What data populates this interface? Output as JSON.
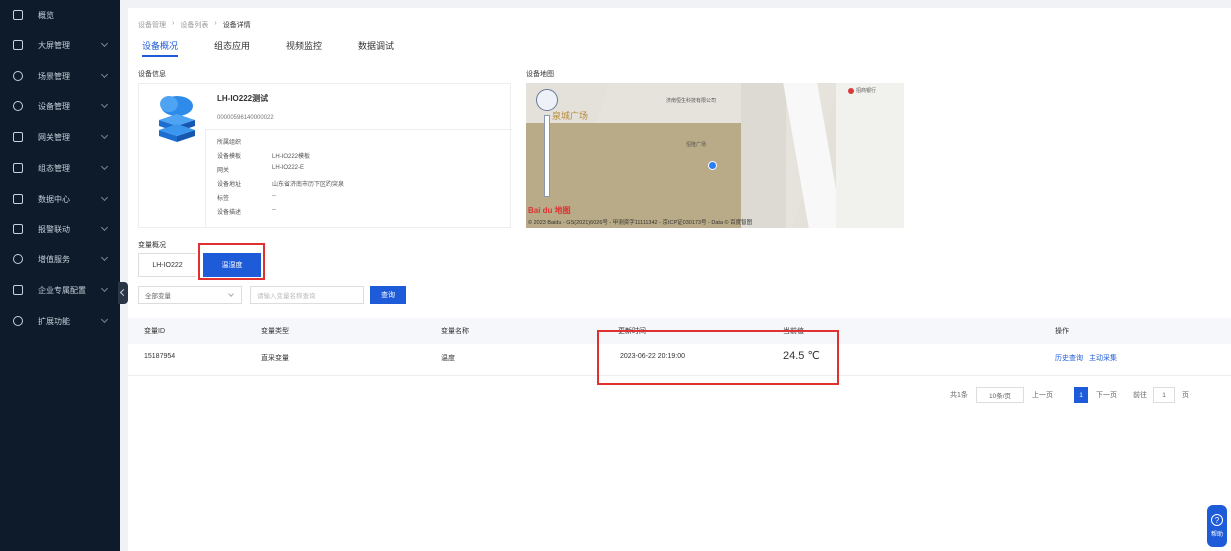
{
  "sidebar": {
    "items": [
      {
        "label": "概览",
        "icon": "monitor-icon"
      },
      {
        "label": "大屏管理",
        "icon": "screen-icon"
      },
      {
        "label": "场景管理",
        "icon": "scene-icon"
      },
      {
        "label": "设备管理",
        "icon": "device-icon"
      },
      {
        "label": "网关管理",
        "icon": "gateway-icon"
      },
      {
        "label": "组态管理",
        "icon": "config-icon"
      },
      {
        "label": "数据中心",
        "icon": "chart-icon"
      },
      {
        "label": "报警联动",
        "icon": "alarm-icon"
      },
      {
        "label": "增值服务",
        "icon": "service-icon"
      },
      {
        "label": "企业专属配置",
        "icon": "enterprise-icon"
      },
      {
        "label": "扩展功能",
        "icon": "extend-icon"
      }
    ]
  },
  "breadcrumb": [
    "设备管理",
    "设备列表",
    "设备详情"
  ],
  "tabs": [
    "设备概况",
    "组态应用",
    "视频监控",
    "数据调试"
  ],
  "device_info": {
    "section_title": "设备信息",
    "name": "LH-IO222测试",
    "code": "00000596140000022",
    "fields": [
      {
        "k": "所属组织",
        "v": ""
      },
      {
        "k": "设备模板",
        "v": "LH-IO222模板"
      },
      {
        "k": "网关",
        "v": "LH-IO222-E"
      },
      {
        "k": "设备地址",
        "v": "山东省济南市历下区趵突泉"
      },
      {
        "k": "标签",
        "v": "--"
      },
      {
        "k": "设备描述",
        "v": "--"
      }
    ]
  },
  "map": {
    "section_title": "设备地图",
    "plaza_label": "泉城广场",
    "poi_1": "济南恒生科技有限公司",
    "poi_2": "招商银行",
    "poi_3": "恒隆广场",
    "logo": "Bai du 地图",
    "copyright": "© 2023 Baidu - GS(2021)6026号 - 甲测资字11111342 - 京ICP证030173号 - Data © 百度智图"
  },
  "variables": {
    "section_title": "变量概况",
    "device_chip": "LH-IO222",
    "selected_button": "温湿度"
  },
  "filters": {
    "select_value": "全部变量",
    "search_placeholder": "请输入变量名称查询",
    "search_button": "查询"
  },
  "table": {
    "headers": [
      "变量ID",
      "变量类型",
      "变量名称",
      "更新时间",
      "当前值",
      "操作"
    ],
    "rows": [
      {
        "id": "15187954",
        "type": "直采变量",
        "name": "温度",
        "updated": "2023-06-22 20:19:00",
        "value": "24.5 ℃",
        "action_1": "历史查询",
        "action_2": "主动采集"
      }
    ]
  },
  "pagination": {
    "total": "共1条",
    "page_size": "10条/页",
    "prev": "上一页",
    "current": "1",
    "next": "下一页",
    "goto_label": "前往",
    "goto_value": "1",
    "page_unit": "页"
  },
  "help": {
    "label": "帮助"
  },
  "colors": {
    "primary": "#1e5bd9",
    "sidebar": "#0d1b2a",
    "highlight": "#e03030"
  }
}
